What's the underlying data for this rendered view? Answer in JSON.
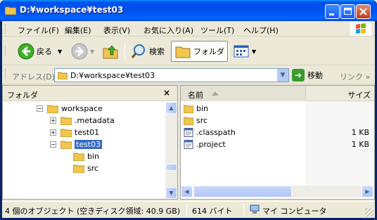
{
  "window": {
    "title": "D:¥workspace¥test03",
    "colors": {
      "titlebar": "#0053ee",
      "selection": "#316ac5",
      "chrome": "#ece9d8"
    }
  },
  "menu": {
    "items": [
      "ファイル(F)",
      "編集(E)",
      "表示(V)",
      "お気に入り(A)",
      "ツール(T)",
      "ヘルプ(H)"
    ]
  },
  "toolbar": {
    "back_label": "戻る",
    "search_label": "検索",
    "folders_label": "フォルダ"
  },
  "address": {
    "label": "アドレス(D)",
    "value": "D:¥workspace¥test03",
    "go_label": "移動",
    "links_label": "リンク"
  },
  "folder_pane": {
    "title": "フォルダ",
    "close_glyph": "×",
    "tree": [
      {
        "label": "workspace",
        "expander": "−"
      },
      {
        "label": ".metadata",
        "expander": "+"
      },
      {
        "label": "test01",
        "expander": "+"
      },
      {
        "label": "test03",
        "expander": "−"
      },
      {
        "label": "bin",
        "expander": ""
      },
      {
        "label": "src",
        "expander": ""
      }
    ]
  },
  "content_pane": {
    "columns": {
      "name": "名前",
      "size": "サイズ"
    },
    "files": [
      {
        "name": "bin",
        "size": "",
        "icon": "folder-icon"
      },
      {
        "name": "src",
        "size": "",
        "icon": "folder-icon"
      },
      {
        "name": ".classpath",
        "size": "1 KB",
        "icon": "file-icon"
      },
      {
        "name": ".project",
        "size": "1 KB",
        "icon": "file-icon"
      }
    ]
  },
  "status": {
    "objects": "4 個のオブジェクト (空きディスク領域: 40.9 GB)",
    "bytes": "614 バイト",
    "location": "マイ コンピュータ"
  }
}
